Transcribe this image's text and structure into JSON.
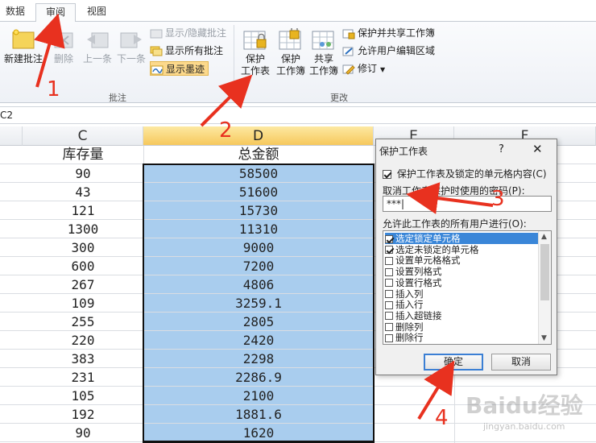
{
  "ribbon": {
    "tabs": [
      {
        "label": "数据",
        "active": false
      },
      {
        "label": "审阅",
        "active": true
      },
      {
        "label": "视图",
        "active": false
      }
    ],
    "comments_group": {
      "label": "批注",
      "new_comment": "新建批注",
      "delete": "删除",
      "previous": "上一条",
      "next": "下一条",
      "show_hide": "显示/隐藏批注",
      "show_all": "显示所有批注",
      "show_ink": "显示墨迹"
    },
    "changes_group": {
      "label": "更改",
      "protect_sheet": [
        "保护",
        "工作表"
      ],
      "protect_workbook": [
        "保护",
        "工作簿"
      ],
      "share_workbook": [
        "共享",
        "工作簿"
      ],
      "protect_share": "保护并共享工作簿",
      "allow_edit_ranges": "允许用户编辑区域",
      "track_changes": "修订"
    }
  },
  "formula_bar": {
    "name_box": "C2"
  },
  "sheet": {
    "columns": [
      "C",
      "D",
      "E",
      "F"
    ],
    "selected_column": "D",
    "header_c": "库存量",
    "header_d": "总金额",
    "col_c": [
      "90",
      "43",
      "121",
      "1300",
      "300",
      "600",
      "267",
      "109",
      "255",
      "220",
      "383",
      "231",
      "105",
      "192",
      "90"
    ],
    "col_d": [
      "58500",
      "51600",
      "15730",
      "11310",
      "9000",
      "7200",
      "4806",
      "3259.1",
      "2805",
      "2420",
      "2298",
      "2286.9",
      "2100",
      "1881.6",
      "1620"
    ]
  },
  "dialog": {
    "title": "保护工作表",
    "help": "?",
    "close": "✕",
    "protect_contents_label": "保护工作表及锁定的单元格内容(C)",
    "password_label": "取消工作表保护时使用的密码(P):",
    "password_value": "***|",
    "allow_label": "允许此工作表的所有用户进行(O):",
    "permissions": [
      {
        "label": "选定锁定单元格",
        "checked": true
      },
      {
        "label": "选定未锁定的单元格",
        "checked": true
      },
      {
        "label": "设置单元格格式",
        "checked": false
      },
      {
        "label": "设置列格式",
        "checked": false
      },
      {
        "label": "设置行格式",
        "checked": false
      },
      {
        "label": "插入列",
        "checked": false
      },
      {
        "label": "插入行",
        "checked": false
      },
      {
        "label": "插入超链接",
        "checked": false
      },
      {
        "label": "删除列",
        "checked": false
      },
      {
        "label": "删除行",
        "checked": false
      }
    ],
    "ok": "确定",
    "cancel": "取消"
  },
  "annotations": {
    "step1": "1",
    "step2": "2",
    "step3": "3",
    "step4": "4",
    "color": "#e8311f"
  },
  "watermark": {
    "brand": "Baidu经验",
    "url": "jingyan.baidu.com"
  }
}
